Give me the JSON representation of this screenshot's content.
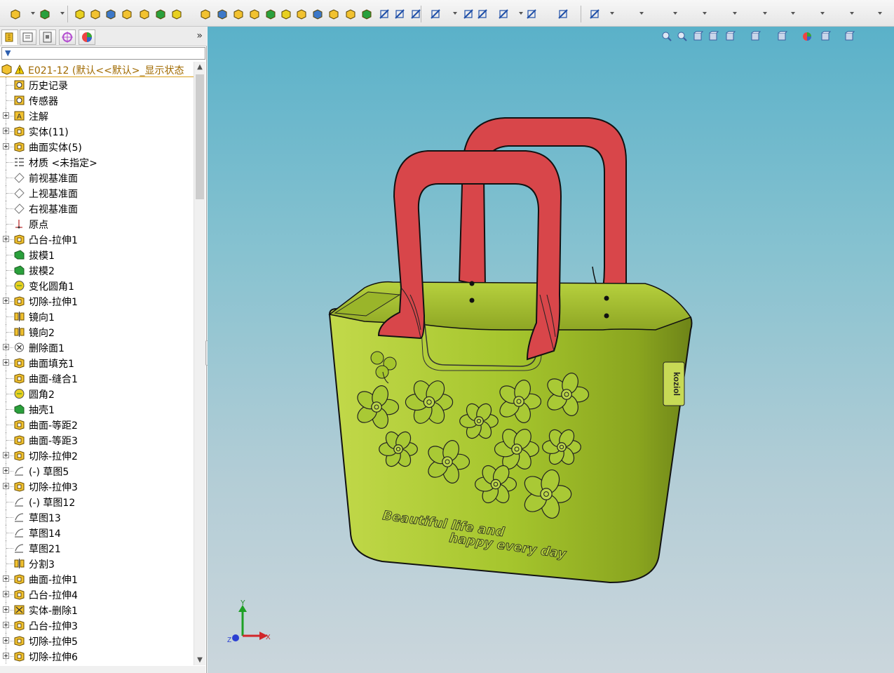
{
  "feature_tree": {
    "root_label": "E021-12 (默认<<默认>_显示状态",
    "items": [
      {
        "label": "历史记录",
        "icon": "history-icon",
        "expandable": false
      },
      {
        "label": "传感器",
        "icon": "sensor-icon",
        "expandable": false
      },
      {
        "label": "注解",
        "icon": "annotation-icon",
        "expandable": true
      },
      {
        "label": "实体(11)",
        "icon": "solid-bodies-icon",
        "expandable": true
      },
      {
        "label": "曲面实体(5)",
        "icon": "surface-bodies-icon",
        "expandable": true
      },
      {
        "label": "材质 <未指定>",
        "icon": "material-icon",
        "expandable": false
      },
      {
        "label": "前视基准面",
        "icon": "plane-icon",
        "expandable": false
      },
      {
        "label": "上视基准面",
        "icon": "plane-icon",
        "expandable": false
      },
      {
        "label": "右视基准面",
        "icon": "plane-icon",
        "expandable": false
      },
      {
        "label": "原点",
        "icon": "origin-icon",
        "expandable": false
      },
      {
        "label": "凸台-拉伸1",
        "icon": "boss-extrude-icon",
        "expandable": true
      },
      {
        "label": "拔模1",
        "icon": "draft-icon",
        "expandable": false
      },
      {
        "label": "拔模2",
        "icon": "draft-icon",
        "expandable": false
      },
      {
        "label": "变化圆角1",
        "icon": "fillet-icon",
        "expandable": false
      },
      {
        "label": "切除-拉伸1",
        "icon": "cut-extrude-icon",
        "expandable": true
      },
      {
        "label": "镜向1",
        "icon": "mirror-icon",
        "expandable": false
      },
      {
        "label": "镜向2",
        "icon": "mirror-icon",
        "expandable": false
      },
      {
        "label": "删除面1",
        "icon": "delete-face-icon",
        "expandable": true
      },
      {
        "label": "曲面填充1",
        "icon": "surface-fill-icon",
        "expandable": true
      },
      {
        "label": "曲面-缝合1",
        "icon": "surface-knit-icon",
        "expandable": false
      },
      {
        "label": "圆角2",
        "icon": "fillet-icon",
        "expandable": false
      },
      {
        "label": "抽壳1",
        "icon": "shell-icon",
        "expandable": false
      },
      {
        "label": "曲面-等距2",
        "icon": "surface-offset-icon",
        "expandable": false
      },
      {
        "label": "曲面-等距3",
        "icon": "surface-offset-icon",
        "expandable": false
      },
      {
        "label": "切除-拉伸2",
        "icon": "cut-extrude-icon",
        "expandable": true
      },
      {
        "label": "(-) 草图5",
        "icon": "sketch-icon",
        "expandable": true
      },
      {
        "label": "切除-拉伸3",
        "icon": "cut-extrude-icon",
        "expandable": true
      },
      {
        "label": "(-) 草图12",
        "icon": "sketch-icon",
        "expandable": false
      },
      {
        "label": "草图13",
        "icon": "sketch-icon",
        "expandable": false
      },
      {
        "label": "草图14",
        "icon": "sketch-icon",
        "expandable": false
      },
      {
        "label": "草图21",
        "icon": "sketch-icon",
        "expandable": false
      },
      {
        "label": "分割3",
        "icon": "split-icon",
        "expandable": false
      },
      {
        "label": "曲面-拉伸1",
        "icon": "surface-extrude-icon",
        "expandable": true
      },
      {
        "label": "凸台-拉伸4",
        "icon": "boss-extrude-icon",
        "expandable": true
      },
      {
        "label": "实体-删除1",
        "icon": "delete-body-icon",
        "expandable": true
      },
      {
        "label": "凸台-拉伸3",
        "icon": "boss-extrude-icon",
        "expandable": true
      },
      {
        "label": "切除-拉伸5",
        "icon": "cut-extrude-icon",
        "expandable": true
      },
      {
        "label": "切除-拉伸6",
        "icon": "cut-extrude-icon",
        "expandable": true
      }
    ]
  },
  "panel": {
    "expand_label": "»",
    "tabs": [
      "feature-manager-tab",
      "property-manager-tab",
      "configuration-manager-tab",
      "dimxpert-tab",
      "display-manager-tab"
    ]
  },
  "model": {
    "front_text_line1": "Beautiful life and",
    "front_text_line2": "happy every day",
    "logo_text": "koziol",
    "body_color": "#a3c42a",
    "handle_color": "#d8464a"
  },
  "triad": {
    "x_label": "X",
    "y_label": "Y",
    "z_label": "Z"
  },
  "colors": {
    "root_text": "#a06a00",
    "viewport_top": "#5ab1c9",
    "viewport_bottom": "#cbd6dc"
  }
}
